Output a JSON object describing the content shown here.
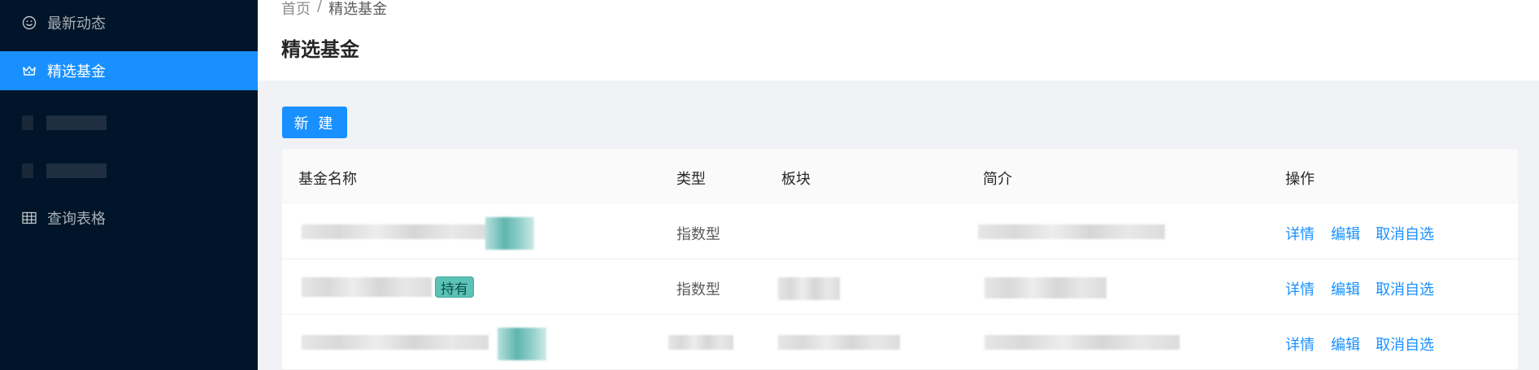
{
  "sidebar": {
    "items": [
      {
        "label": "最新动态",
        "icon": "smile-icon"
      },
      {
        "label": "精选基金",
        "icon": "crown-icon",
        "active": true
      },
      {
        "label": "",
        "icon": "blurred-icon"
      },
      {
        "label": "",
        "icon": "blurred-icon"
      },
      {
        "label": "查询表格",
        "icon": "table-icon"
      }
    ]
  },
  "header": {
    "breadcrumb": [
      "首页",
      "精选基金"
    ],
    "separator": "/",
    "title": "精选基金"
  },
  "toolbar": {
    "new_label": "新 建"
  },
  "table": {
    "columns": [
      "基金名称",
      "类型",
      "板块",
      "简介",
      "操作"
    ],
    "rows": [
      {
        "name": "",
        "type": "指数型",
        "sector": "",
        "intro": "",
        "tag": ""
      },
      {
        "name": "",
        "type": "指数型",
        "sector": "",
        "intro": "",
        "tag": "持有"
      },
      {
        "name": "",
        "type": "",
        "sector": "",
        "intro": "",
        "tag": ""
      }
    ],
    "actions": [
      "详情",
      "编辑",
      "取消自选"
    ]
  },
  "colors": {
    "primary": "#1890ff",
    "sidebar_bg": "#001529",
    "tag_bg": "#5cc2b8"
  }
}
